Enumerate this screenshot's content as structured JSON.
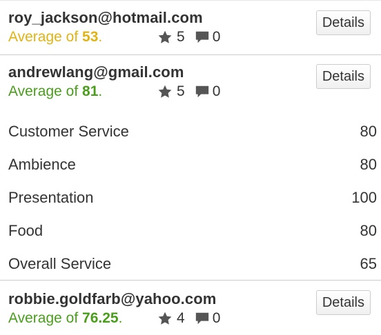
{
  "reviews": [
    {
      "email": "roy_jackson@hotmail.com",
      "average_prefix": "Average of ",
      "average_value": "53",
      "average_suffix": ".",
      "average_color": "#e0b414",
      "stars": "5",
      "comments": "0",
      "details_label": "Details"
    },
    {
      "email": "andrewlang@gmail.com",
      "average_prefix": "Average of ",
      "average_value": "81",
      "average_suffix": ".",
      "average_color": "#4a9e1c",
      "stars": "5",
      "comments": "0",
      "details_label": "Details",
      "categories": [
        {
          "label": "Customer Service",
          "score": "80"
        },
        {
          "label": "Ambience",
          "score": "80"
        },
        {
          "label": "Presentation",
          "score": "100"
        },
        {
          "label": "Food",
          "score": "80"
        },
        {
          "label": "Overall Service",
          "score": "65"
        }
      ]
    },
    {
      "email": "robbie.goldfarb@yahoo.com",
      "average_prefix": "Average of ",
      "average_value": "76.25",
      "average_suffix": ".",
      "average_color": "#4a9e1c",
      "stars": "4",
      "comments": "0",
      "details_label": "Details"
    }
  ],
  "icons": {
    "rating": "star-icon",
    "comments": "comment-icon"
  }
}
